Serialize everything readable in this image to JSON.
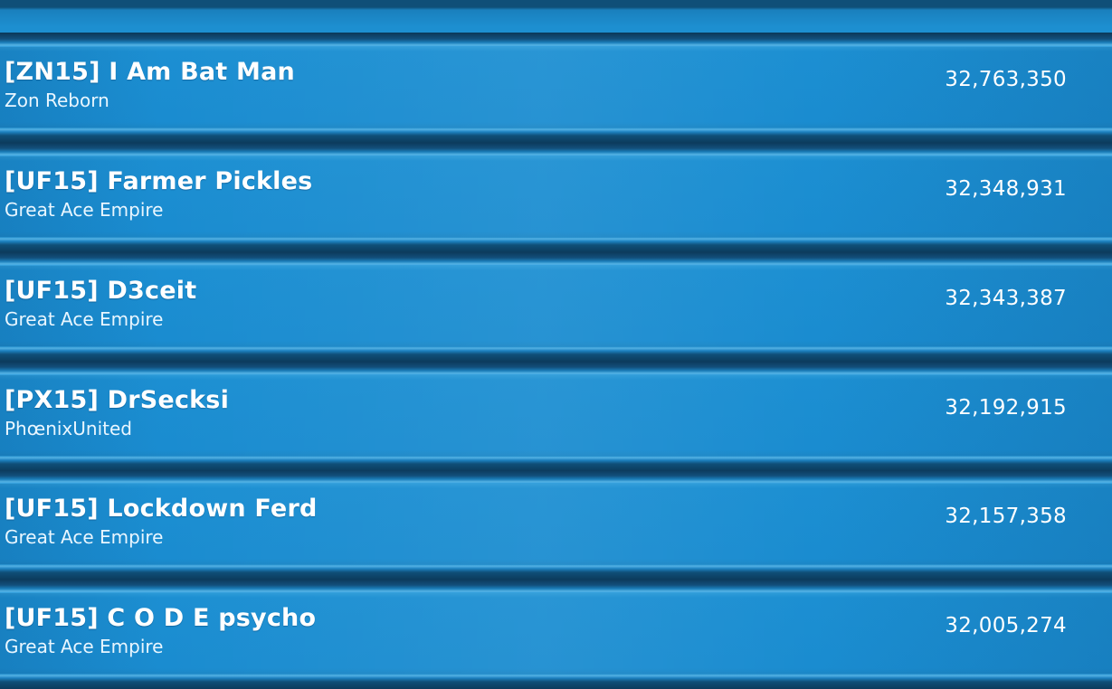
{
  "leaderboard": {
    "entries": [
      {
        "player": "[ZN15] I Am Bat Man",
        "team": "Zon Reborn",
        "score": "32,763,350"
      },
      {
        "player": "[UF15] Farmer Pickles",
        "team": "Great Ace Empire",
        "score": "32,348,931"
      },
      {
        "player": "[UF15] D3ceit",
        "team": "Great Ace Empire",
        "score": "32,343,387"
      },
      {
        "player": "[PX15] DrSecksi",
        "team": "PhœnixUnited",
        "score": "32,192,915"
      },
      {
        "player": "[UF15] Lockdown Ferd",
        "team": "Great Ace Empire",
        "score": "32,157,358"
      },
      {
        "player": "[UF15] C O D E psycho",
        "team": "Great Ace Empire",
        "score": "32,005,274"
      }
    ]
  }
}
